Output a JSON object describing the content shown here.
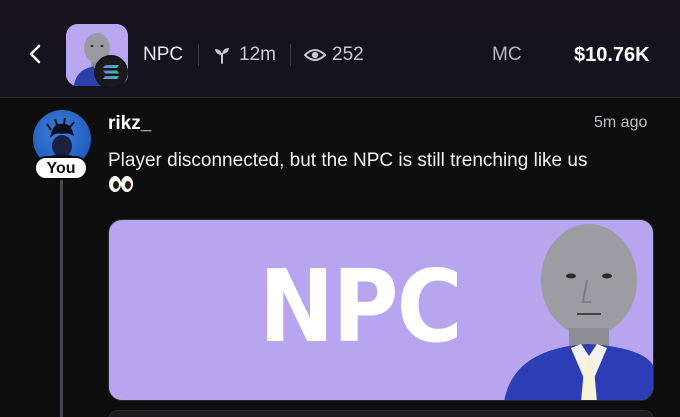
{
  "header": {
    "back_icon": "chevron-left-icon",
    "token_ticker": "NPC",
    "age": "12m",
    "age_icon": "sprout-icon",
    "views": "252",
    "views_icon": "eye-icon",
    "mc_label": "MC",
    "mc_value": "$10.76K",
    "chain_icon": "solana-icon"
  },
  "post": {
    "username": "rikz_",
    "you_badge": "You",
    "timestamp": "5m ago",
    "text": "Player disconnected, but the NPC is still trenching like us",
    "emoji": "eyes-emoji",
    "image_text": "NPC"
  },
  "colors": {
    "background": "#0d0d0d",
    "header_bg": "#17131f",
    "image_bg": "#b7a6ef",
    "avatar_blue": "#2563c4"
  }
}
